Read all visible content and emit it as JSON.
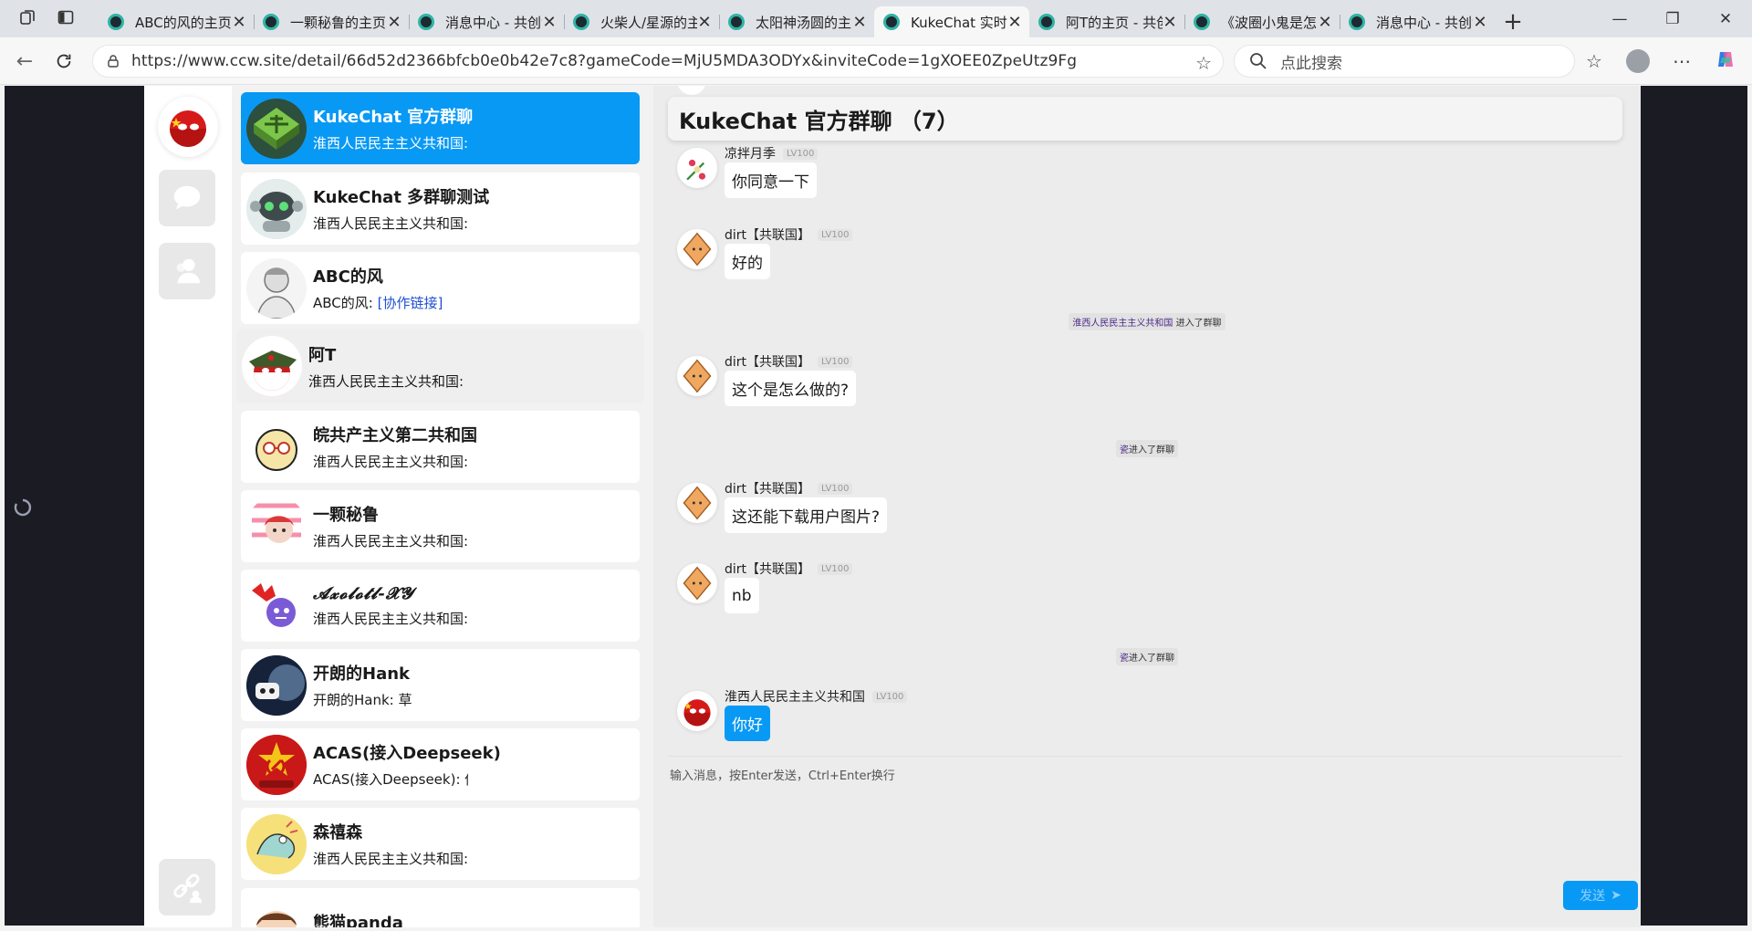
{
  "browser": {
    "tabs": [
      {
        "title": "ABC的风的主页 - 共创世界"
      },
      {
        "title": "一颗秘鲁的主页 - 共创世界"
      },
      {
        "title": "消息中心 - 共创世界"
      },
      {
        "title": "火柴人/星源的主页 - 共创世界"
      },
      {
        "title": "太阳神汤圆的主页 - 共创世界"
      },
      {
        "title": "KukeChat 实时聊天"
      },
      {
        "title": "阿T的主页 - 共创世界"
      },
      {
        "title": "《波圈小鬼是怎么做的》"
      },
      {
        "title": "消息中心 - 共创世界"
      }
    ],
    "active_tab_index": 5,
    "url": "https://www.ccw.site/detail/66d52d2366bfcb0e0b42e7c8?gameCode=MjU5MDA3ODYx&inviteCode=1gXOEE0ZpeUtz9Fg",
    "search_placeholder": "点此搜索"
  },
  "contacts": [
    {
      "name": "KukeChat 官方群聊",
      "last": "淮西人民民主主义共和国: 你好",
      "active": true,
      "avatar_icon": "maze-avatar"
    },
    {
      "name": "KukeChat 多群聊测试",
      "last": "淮西人民民主主义共和国: 你好",
      "avatar_icon": "robot-avatar"
    },
    {
      "name": "ABC的风",
      "last_prefix": "ABC的风: ",
      "last_link": "[协作链接]",
      "avatar_icon": "sketch-avatar"
    },
    {
      "name": "阿T",
      "last": "淮西人民民主主义共和国: 你好",
      "hover": true,
      "avatar_icon": "countryball-hat-avatar"
    },
    {
      "name": "皖共产主义第二共和国",
      "last": "淮西人民民主主义共和国: 你好",
      "avatar_icon": "glasses-ball-avatar"
    },
    {
      "name": "一颗秘鲁",
      "last": "淮西人民民主主义共和国: 你好",
      "avatar_icon": "anime-girl-avatar"
    },
    {
      "name": "𝓐𝔁𝓸𝓵𝓸𝓽𝓵-𝓧𝓨",
      "last": "淮西人民民主主义共和国: 你好",
      "avatar_icon": "purple-monster-avatar"
    },
    {
      "name": "开朗的Hank",
      "last": "开朗的Hank: 草",
      "avatar_icon": "planet-avatar"
    },
    {
      "name": "ACAS(接入Deepseek)",
      "last": "ACAS(接入Deepseek): 你好",
      "avatar_icon": "hammer-sickle-avatar"
    },
    {
      "name": "森禧森",
      "last": "淮西人民民主主义共和国: 你好",
      "avatar_icon": "doodle-avatar"
    },
    {
      "name": "熊猫panda",
      "last": "",
      "avatar_icon": "cartoon-boy-avatar"
    }
  ],
  "chat": {
    "title": "KukeChat 官方群聊 （7）",
    "messages": [
      {
        "sender": "凉拌月季",
        "level": "LV100",
        "text": "你同意一下"
      },
      {
        "sender": "dirt【共联国】",
        "level": "LV100",
        "text": "好的"
      },
      {
        "sender": "dirt【共联国】",
        "level": "LV100",
        "text": "这个是怎么做的?"
      },
      {
        "sender": "dirt【共联国】",
        "level": "LV100",
        "text": "这还能下载用户图片?"
      },
      {
        "sender": "dirt【共联国】",
        "level": "LV100",
        "text": "nb"
      },
      {
        "sender": "淮西人民民主主义共和国",
        "level": "LV100",
        "text": "你好",
        "mine": true
      }
    ],
    "system_messages": [
      {
        "who": "淮西人民民主主义共和国",
        "action": "进入了群聊"
      },
      {
        "who": "瓷",
        "action": "进入了群聊"
      },
      {
        "who": "瓷",
        "action": "进入了群聊"
      }
    ],
    "input_placeholder": "输入消息，按Enter发送，Ctrl+Enter换行",
    "send_label": "发送",
    "send_icon": "➤"
  },
  "colors": {
    "accent": "#0899f5",
    "page_bg": "#1b1b24",
    "chat_bg": "#ececec"
  }
}
